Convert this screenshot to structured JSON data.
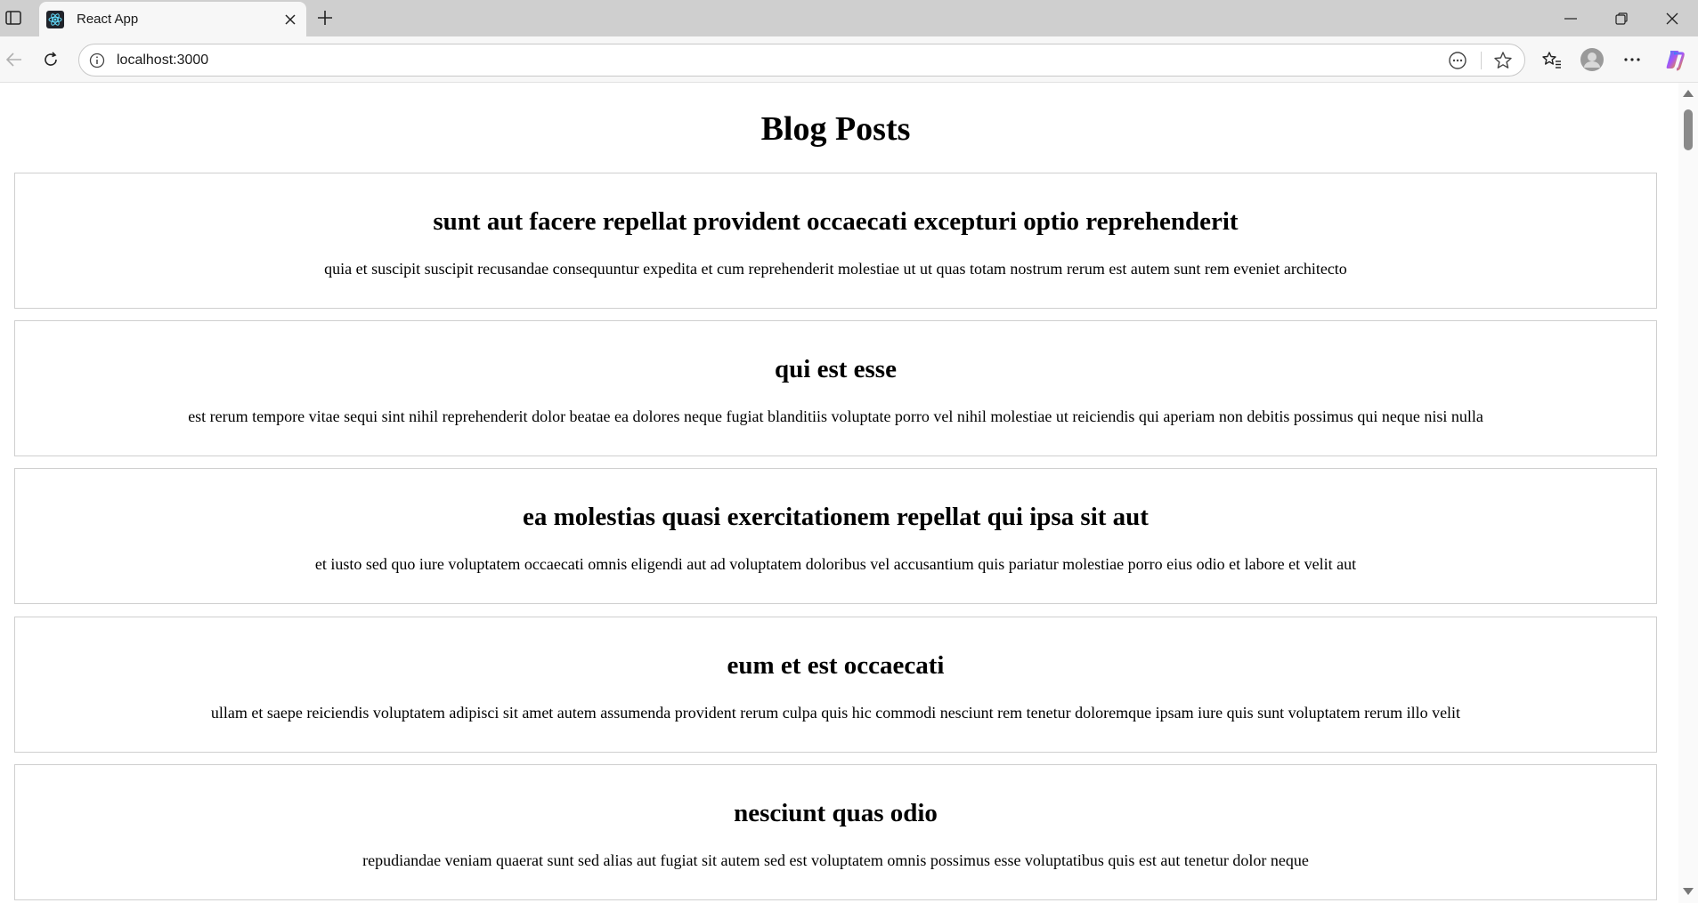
{
  "browser": {
    "tab_title": "React App",
    "url": "localhost:3000"
  },
  "page": {
    "title": "Blog Posts",
    "posts": [
      {
        "title": "sunt aut facere repellat provident occaecati excepturi optio reprehenderit",
        "body": "quia et suscipit suscipit recusandae consequuntur expedita et cum reprehenderit molestiae ut ut quas totam nostrum rerum est autem sunt rem eveniet architecto"
      },
      {
        "title": "qui est esse",
        "body": "est rerum tempore vitae sequi sint nihil reprehenderit dolor beatae ea dolores neque fugiat blanditiis voluptate porro vel nihil molestiae ut reiciendis qui aperiam non debitis possimus qui neque nisi nulla"
      },
      {
        "title": "ea molestias quasi exercitationem repellat qui ipsa sit aut",
        "body": "et iusto sed quo iure voluptatem occaecati omnis eligendi aut ad voluptatem doloribus vel accusantium quis pariatur molestiae porro eius odio et labore et velit aut"
      },
      {
        "title": "eum et est occaecati",
        "body": "ullam et saepe reiciendis voluptatem adipisci sit amet autem assumenda provident rerum culpa quis hic commodi nesciunt rem tenetur doloremque ipsam iure quis sunt voluptatem rerum illo velit"
      },
      {
        "title": "nesciunt quas odio",
        "body": "repudiandae veniam quaerat sunt sed alias aut fugiat sit autem sed est voluptatem omnis possimus esse voluptatibus quis est aut tenetur dolor neque"
      }
    ]
  },
  "colors": {
    "tab_strip": "#cfcfcf",
    "toolbar": "#f7f7f7",
    "card_border": "#cfcfcf",
    "text": "#000000"
  }
}
